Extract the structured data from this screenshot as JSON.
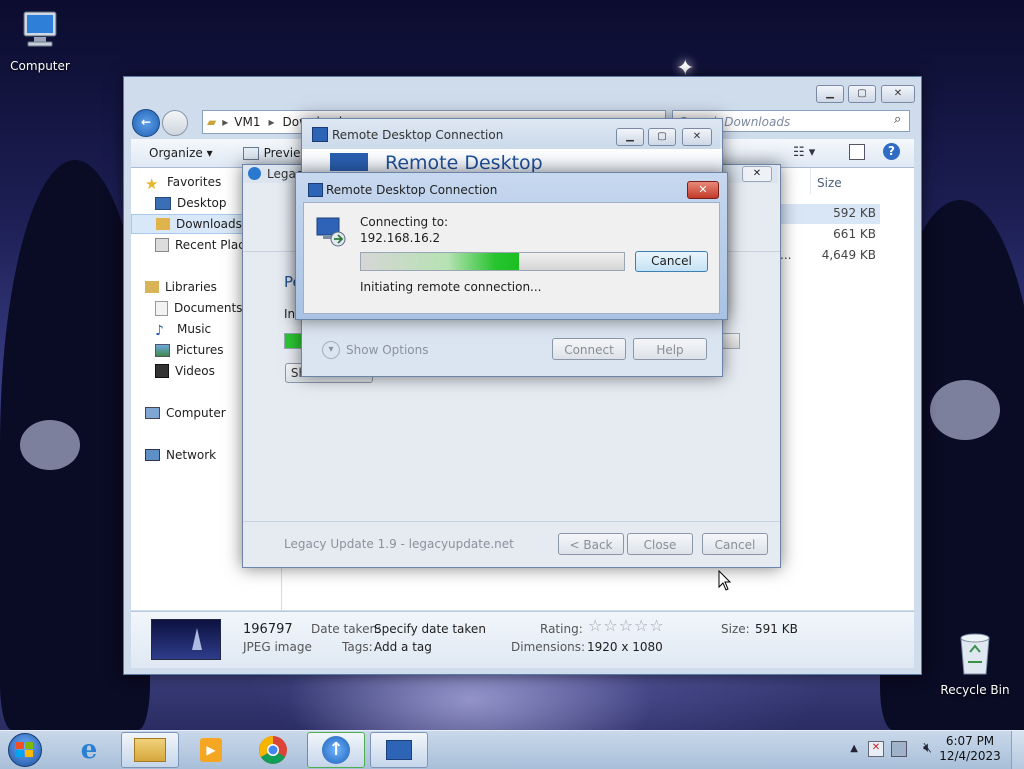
{
  "desktop": {
    "computer_label": "Computer",
    "recycle_label": "Recycle Bin"
  },
  "explorer": {
    "breadcrumb": [
      "VM1",
      "Downloads"
    ],
    "search_placeholder": "Search Downloads",
    "toolbar": {
      "organize": "Organize",
      "preview": "Preview"
    },
    "nav": {
      "favorites": "Favorites",
      "desktop": "Desktop",
      "downloads": "Downloads",
      "recent": "Recent Places",
      "libraries": "Libraries",
      "documents": "Documents",
      "music": "Music",
      "pictures": "Pictures",
      "videos": "Videos",
      "computer": "Computer",
      "network": "Network"
    },
    "column_size": "Size",
    "rows": [
      {
        "size": "592 KB"
      },
      {
        "size": "661 KB"
      },
      {
        "name_tail": "...",
        "size": "4,649 KB"
      }
    ],
    "details": {
      "name": "196797",
      "type": "JPEG image",
      "date_label": "Date taken:",
      "date_value": "Specify date taken",
      "tags_label": "Tags:",
      "tags_value": "Add a tag",
      "rating_label": "Rating:",
      "rating_stars": 0,
      "dimensions_label": "Dimensions:",
      "dimensions_value": "1920 x 1080",
      "size_label": "Size:",
      "size_value": "591 KB"
    }
  },
  "legacy": {
    "title": "Legacy Update",
    "heading_partial": "Pe",
    "status_partial": "Ins",
    "show_details": "Show details",
    "footer_text": "Legacy Update 1.9 - legacyupdate.net",
    "back": "< Back",
    "close": "Close",
    "cancel": "Cancel"
  },
  "rdc_back": {
    "title": "Remote Desktop Connection",
    "banner": "Remote Desktop",
    "show_options": "Show Options",
    "connect": "Connect",
    "help": "Help"
  },
  "rdc_front": {
    "title": "Remote Desktop Connection",
    "connecting_label": "Connecting to:",
    "ip": "192.168.16.2",
    "status": "Initiating remote connection...",
    "cancel": "Cancel",
    "progress": 0.6
  },
  "tray": {
    "time": "6:07 PM",
    "date": "12/4/2023"
  }
}
